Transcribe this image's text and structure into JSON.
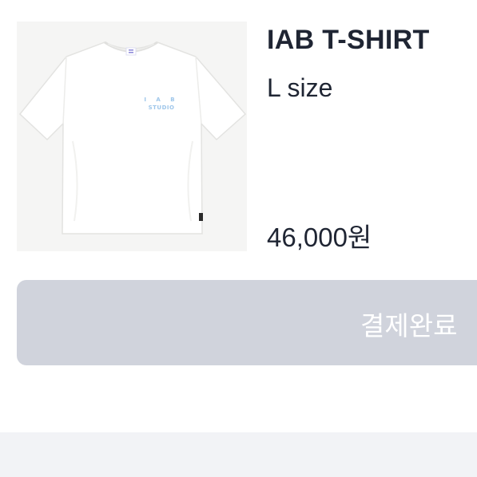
{
  "product": {
    "name": "IAB T-SHIRT",
    "option": "L size",
    "price": "46,000원",
    "image_icon": "tshirt-image",
    "logo_text_top": "I A B",
    "logo_text_bottom": "STUDIO",
    "logo_color": "#9ec6ea"
  },
  "payment": {
    "button_label": "결제완료",
    "button_color": "#d0d3dc"
  },
  "colors": {
    "text_primary": "#1f2533",
    "page_background": "#f2f3f6"
  }
}
